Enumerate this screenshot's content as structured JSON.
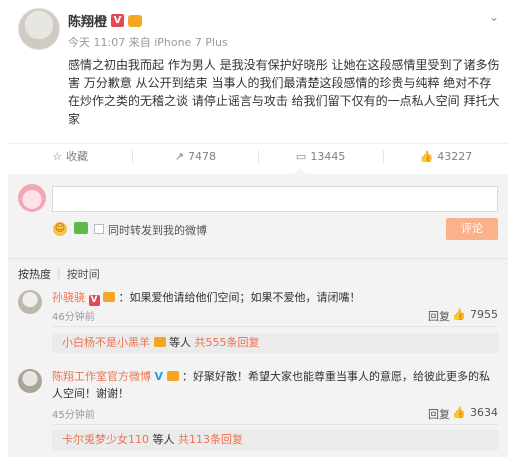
{
  "post": {
    "author": "陈翔橙",
    "meta": "今天 11:07 来自 iPhone 7 Plus",
    "text": "感情之初由我而起 作为男人 是我没有保护好晓彤 让她在这段感情里受到了诸多伤害 万分歉意 从公开到结束 当事人的我们最清楚这段感情的珍贵与纯粹 绝对不存在炒作之类的无稽之谈 请停止谣言与攻击 给我们留下仅有的一点私人空间 拜托大家"
  },
  "actions": {
    "favorite_label": "收藏",
    "repost_count": "7478",
    "comment_count": "13445",
    "like_count": "43227"
  },
  "compose": {
    "repost_label": "同时转发到我的微博",
    "submit_label": "评论",
    "input_value": ""
  },
  "sort": {
    "hot": "按热度",
    "time": "按时间"
  },
  "comments": [
    {
      "user": "孙骁骁",
      "text": "：如果爱他请给他们空间；如果不爱他，请闭嘴！",
      "time": "46分钟前",
      "reply_label": "回复",
      "likes": "7955",
      "sub_user": "小白杨不是小黑羊",
      "sub_suffix": "等人",
      "sub_count": "共555条回复"
    },
    {
      "user": "陈翔工作室官方微博",
      "text": "：好聚好散！希望大家也能尊重当事人的意愿，给彼此更多的私人空间！谢谢！",
      "time": "45分钟前",
      "reply_label": "回复",
      "likes": "3634",
      "sub_user": "卡尔兎梦少女110",
      "sub_suffix": "等人",
      "sub_count": "共113条回复"
    }
  ]
}
